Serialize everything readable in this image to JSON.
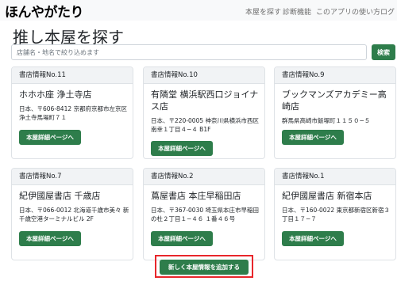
{
  "navbar": {
    "brand": "ほんやがたり",
    "links": [
      {
        "label": "本屋を探す"
      },
      {
        "label": "診断機能"
      },
      {
        "label": "このアプリの使い方"
      },
      {
        "label": "ログ"
      }
    ]
  },
  "page": {
    "title": "推し本屋を探す"
  },
  "search": {
    "placeholder": "店舗名・地名で絞り込めます",
    "value": "",
    "button_label": "検索"
  },
  "stores": [
    {
      "header": "書店情報No.11",
      "name": "ホホホ座 浄土寺店",
      "address": "日本、〒606-8412 京都府京都市左京区浄土寺馬場町７１",
      "button_label": "本屋詳細ページへ"
    },
    {
      "header": "書店情報No.10",
      "name": "有隣堂 横浜駅西口ジョイナス店",
      "address": "日本、〒220-0005 神奈川県横浜市西区南幸１丁目４−４ B1F",
      "button_label": "本屋詳細ページへ"
    },
    {
      "header": "書店情報No.9",
      "name": "ブックマンズアカデミー高崎店",
      "address": "群馬県高崎市飯塚町１１５０−５",
      "button_label": "本屋詳細ページへ"
    },
    {
      "header": "書店情報No.7",
      "name": "紀伊國屋書店 千歳店",
      "address": "日本、〒066-0012 北海道千歳市美々 新千歳空港ターミナルビル 2F",
      "button_label": "本屋詳細ページへ"
    },
    {
      "header": "書店情報No.2",
      "name": "蔦屋書店 本庄早稲田店",
      "address": "日本、〒367-0030 埼玉県本庄市早稲田の杜２丁目１−４６ １番４６号",
      "button_label": "本屋詳細ページへ"
    },
    {
      "header": "書店情報No.1",
      "name": "紀伊國屋書店 新宿本店",
      "address": "日本、〒160-0022 東京都新宿区新宿３丁目１７−７",
      "button_label": "本屋詳細ページへ"
    }
  ],
  "add_button": {
    "label": "新しく本屋情報を追加する"
  },
  "colors": {
    "accent_green": "#2e7d4b",
    "highlight_red": "#e8262b",
    "navbar_bg": "#f8f9fa"
  }
}
